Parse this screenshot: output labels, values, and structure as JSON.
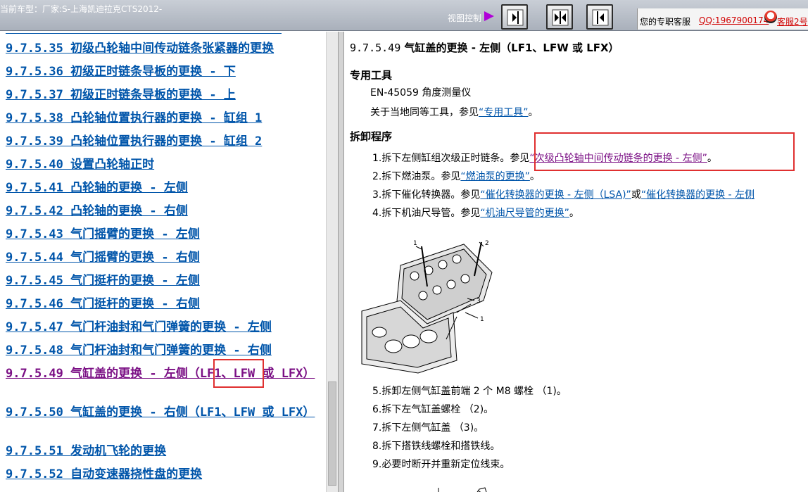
{
  "topbar": {
    "vehicle": "当前车型：厂家:S-上海凯迪拉克CTS2012-",
    "view_label": "视图控制",
    "service_label": "您的专职客服",
    "qq_link": "QQ:1967900174",
    "qq2_link": "客服2号"
  },
  "toc": {
    "items": [
      {
        "text": "9.7.5.35 初级凸轮轴中间传动链条张紧器的更换"
      },
      {
        "text": "9.7.5.36 初级正时链条导板的更换 - 下"
      },
      {
        "text": "9.7.5.37 初级正时链条导板的更换 - 上"
      },
      {
        "text": "9.7.5.38 凸轮轴位置执行器的更换 - 缸组 1"
      },
      {
        "text": "9.7.5.39 凸轮轴位置执行器的更换 - 缸组 2"
      },
      {
        "text": "9.7.5.40 设置凸轮轴正时"
      },
      {
        "text": "9.7.5.41 凸轮轴的更换 - 左侧"
      },
      {
        "text": "9.7.5.42 凸轮轴的更换 - 右侧"
      },
      {
        "text": "9.7.5.43 气门摇臂的更换 - 左侧"
      },
      {
        "text": "9.7.5.44 气门摇臂的更换 - 右侧"
      },
      {
        "text": "9.7.5.45 气门挺杆的更换 - 左侧"
      },
      {
        "text": "9.7.5.46 气门挺杆的更换 - 右侧"
      },
      {
        "text": "9.7.5.47 气门杆油封和气门弹簧的更换 - 左侧"
      },
      {
        "text": "9.7.5.48 气门杆油封和气门弹簧的更换 - 右侧"
      },
      {
        "text": "9.7.5.49 气缸盖的更换 - 左侧（LF1、LFW 或 LFX）"
      },
      {
        "text": "9.7.5.50 气缸盖的更换 - 右侧（LF1、LFW 或 LFX）"
      },
      {
        "text": "9.7.5.51 发动机飞轮的更换"
      },
      {
        "text": "9.7.5.52 自动变速器挠性盘的更换"
      }
    ]
  },
  "doc": {
    "title_num": "9.7.5.49",
    "title_text": "气缸盖的更换 - 左侧（LF1、LFW 或 LFX）",
    "special_tools_heading": "专用工具",
    "tool_line": "EN-45059 角度测量仪",
    "tool_ref_prefix": "关于当地同等工具，参见",
    "tool_ref_link": "“专用工具”",
    "tool_ref_suffix": "。",
    "removal_heading": "拆卸程序",
    "step1_text": "1.拆下左侧缸组次级正时链条。参见",
    "step1_link": "“次级凸轮轴中间传动链条的更换 - 左侧”",
    "step1_suffix": "。",
    "step2_text": "2.拆下燃油泵。参见",
    "step2_link": "“燃油泵的更换”",
    "step2_suffix": "。",
    "step3_text": "3.拆下催化转换器。参见",
    "step3_link1": "“催化转换器的更换 - 左侧（LSA)”",
    "step3_or": "或",
    "step3_link2": "“催化转换器的更换 - 左侧",
    "step4_text": "4.拆下机油尺导管。参见",
    "step4_link": "“机油尺导管的更换”",
    "step4_suffix": "。",
    "step5": "5.拆卸左侧气缸盖前端 2 个 M8 螺栓 （1)。",
    "step6": "6.拆下左气缸盖螺栓 （2)。",
    "step7": "7.拆下左侧气缸盖 （3)。",
    "step8": "8.拆下搭铁线螺栓和搭铁线。",
    "step9": "9.必要时断开并重新定位线束。",
    "callouts": [
      "1",
      "2",
      "3",
      "1"
    ]
  }
}
